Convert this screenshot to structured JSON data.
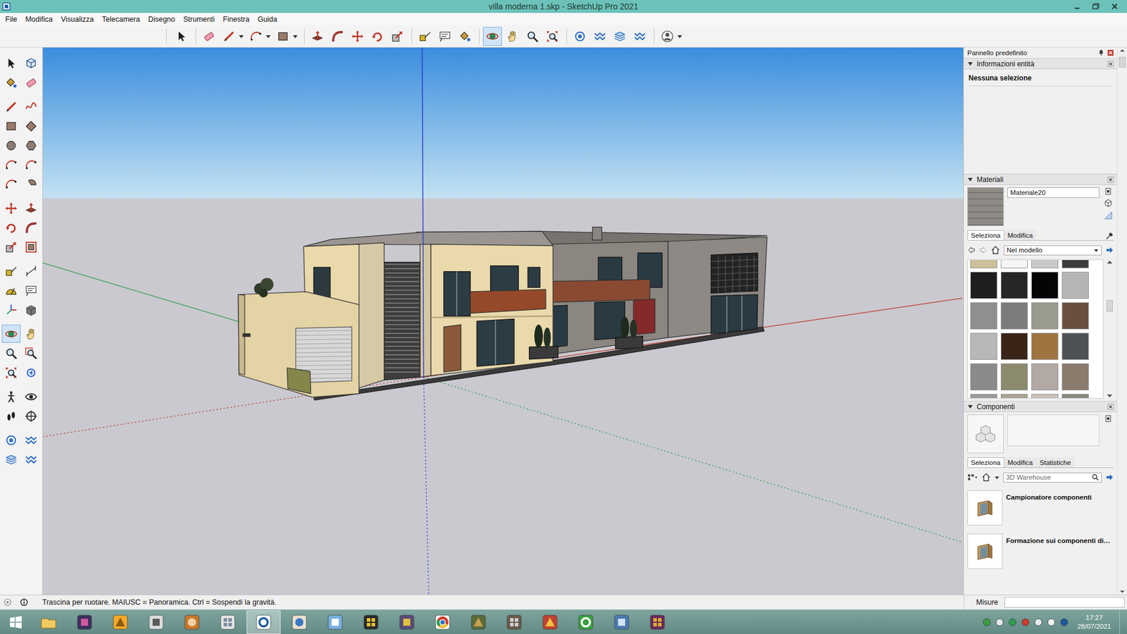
{
  "window": {
    "title": "villa moderna 1.skp - SketchUp Pro 2021"
  },
  "menu": [
    "File",
    "Modifica",
    "Visualizza",
    "Telecamera",
    "Disegno",
    "Strumenti",
    "Finestra",
    "Guida"
  ],
  "toolbar": {
    "buttons": [
      {
        "selected": false
      },
      {
        "selected": false
      },
      {
        "selected": false
      },
      {
        "selected": false
      },
      {
        "selected": false
      },
      {
        "selected": false
      },
      {
        "selected": false
      },
      {
        "selected": false
      },
      {
        "selected": false
      },
      {
        "selected": false
      },
      {
        "selected": false
      },
      {
        "selected": false
      },
      {
        "selected": false
      },
      {
        "selected": true
      },
      {
        "selected": false
      },
      {
        "selected": false
      },
      {
        "selected": false
      },
      {
        "selected": false
      },
      {
        "selected": false
      },
      {
        "selected": false
      },
      {
        "selected": false
      },
      {
        "selected": false
      }
    ]
  },
  "side_toolbar": {
    "buttons": [
      {
        "selected": false
      },
      {
        "selected": false
      },
      {
        "selected": false
      },
      {
        "selected": false
      },
      {
        "selected": false
      },
      {
        "selected": false
      },
      {
        "selected": false
      },
      {
        "selected": false
      },
      {
        "selected": false
      },
      {
        "selected": false
      },
      {
        "selected": false
      },
      {
        "selected": false
      },
      {
        "selected": false
      },
      {
        "selected": false
      },
      {
        "selected": false
      },
      {
        "selected": false
      },
      {
        "selected": false
      },
      {
        "selected": false
      },
      {
        "selected": false
      },
      {
        "selected": false
      },
      {
        "selected": false
      },
      {
        "selected": false
      },
      {
        "selected": false
      },
      {
        "selected": false
      },
      {
        "selected": false
      },
      {
        "selected": false
      },
      {
        "selected": true
      },
      {
        "selected": false
      },
      {
        "selected": false
      },
      {
        "selected": false
      },
      {
        "selected": false
      },
      {
        "selected": false
      },
      {
        "selected": false
      },
      {
        "selected": false
      },
      {
        "selected": false
      },
      {
        "selected": false
      },
      {
        "selected": false
      },
      {
        "selected": false
      },
      {
        "selected": false
      },
      {
        "selected": false
      }
    ]
  },
  "panel": {
    "title": "Pannello predefinito",
    "entity_info": {
      "title": "Informazioni entità",
      "expanded": true,
      "selection": "Nessuna selezione"
    },
    "materials": {
      "title": "Materiali",
      "expanded": true,
      "name": "Materiale20",
      "tabs": [
        {
          "label": "Seleziona",
          "selected": true
        },
        {
          "label": "Modifica",
          "selected": false
        }
      ],
      "collection": "Nel modello",
      "swatches": [
        {
          "color": "#cdbf99"
        },
        {
          "color": "#f6f6f6"
        },
        {
          "color": "#c9c9c9"
        },
        {
          "color": "#3c3c3c"
        },
        {
          "color": "#1e1e1e"
        },
        {
          "color": "#262626"
        },
        {
          "color": "#050505"
        },
        {
          "color": "#b5b5b3"
        },
        {
          "color": "#8f8f8f"
        },
        {
          "color": "#7d7b7c"
        },
        {
          "color": "#9b9a8e"
        },
        {
          "color": "#6b4f3e"
        },
        {
          "color": "#b8b8b8"
        },
        {
          "color": "#3a2418"
        },
        {
          "color": "#a07440"
        },
        {
          "color": "#4d5256"
        },
        {
          "color": "#8a8a88"
        },
        {
          "color": "#8c8a6c"
        },
        {
          "color": "#b2a9a4"
        },
        {
          "color": "#8b7b6c"
        },
        {
          "color": "#9a9a9a"
        },
        {
          "color": "#a8a290"
        },
        {
          "color": "#c8c0b8"
        },
        {
          "color": "#8a8680"
        }
      ]
    },
    "components": {
      "title": "Componenti",
      "expanded": true,
      "name": "",
      "tabs": [
        {
          "label": "Seleziona",
          "selected": true
        },
        {
          "label": "Modifica",
          "selected": false
        },
        {
          "label": "Statistiche",
          "selected": false
        }
      ],
      "search": {
        "placeholder": "3D Warehouse"
      },
      "items": [
        {
          "label": "Campionatore componenti"
        },
        {
          "label": "Formazione sui componenti di…"
        }
      ]
    }
  },
  "status_bar": {
    "hint": "Trascina per ruotare. MAIUSC = Panoramica. Ctrl = Sospendi la gravità.",
    "measure_label": "Misure",
    "measure_value": ""
  },
  "taskbar": {
    "apps": [
      {
        "selected": false
      },
      {
        "selected": false
      },
      {
        "selected": false
      },
      {
        "selected": false
      },
      {
        "selected": false
      },
      {
        "selected": false
      },
      {
        "selected": true
      },
      {
        "selected": false
      },
      {
        "selected": false
      },
      {
        "selected": false
      },
      {
        "selected": false
      },
      {
        "selected": false
      },
      {
        "selected": false
      },
      {
        "selected": false
      },
      {
        "selected": false
      },
      {
        "selected": false
      },
      {
        "selected": false
      },
      {
        "selected": false
      }
    ],
    "time": "17:27",
    "date": "28/07/2021"
  }
}
